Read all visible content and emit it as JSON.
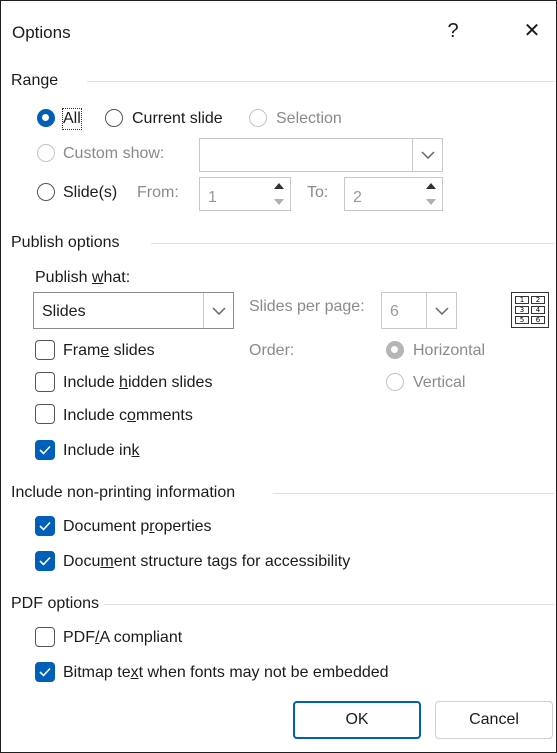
{
  "dialog": {
    "title": "Options",
    "help_label": "?",
    "close_label": "✕"
  },
  "range": {
    "group_label": "Range",
    "all_label": "All",
    "current_slide_label": "Current slide",
    "selection_label": "Selection",
    "custom_show_label": "Custom show:",
    "custom_show_value": "",
    "slides_label": "Slide(s)",
    "from_label": "From:",
    "from_value": "1",
    "to_label": "To:",
    "to_value": "2",
    "selected": "All"
  },
  "publish": {
    "group_label": "Publish options",
    "publish_what_label": "Publish what:",
    "publish_what_value": "Slides",
    "slides_per_page_label": "Slides per page:",
    "slides_per_page_value": "6",
    "order_label": "Order:",
    "horizontal_label": "Horizontal",
    "vertical_label": "Vertical",
    "frame_slides_label": "Frame slides",
    "frame_slides_checked": false,
    "include_hidden_label": "Include hidden slides",
    "include_hidden_checked": false,
    "include_comments_label": "Include comments",
    "include_comments_checked": false,
    "include_ink_label": "Include ink",
    "include_ink_checked": true,
    "layout_icon_cells": [
      "1",
      "2",
      "3",
      "4",
      "5",
      "6"
    ]
  },
  "nonprinting": {
    "group_label": "Include non-printing information",
    "doc_props_label": "Document properties",
    "doc_props_checked": true,
    "structure_tags_label": "Document structure tags for accessibility",
    "structure_tags_checked": true
  },
  "pdf": {
    "group_label": "PDF options",
    "pdfa_label": "PDF/A compliant",
    "pdfa_checked": false,
    "bitmap_label": "Bitmap text when fonts may not be embedded",
    "bitmap_checked": true
  },
  "buttons": {
    "ok_label": "OK",
    "cancel_label": "Cancel"
  },
  "colors": {
    "accent": "#005fb8",
    "disabled_text": "#8a8a8a"
  }
}
